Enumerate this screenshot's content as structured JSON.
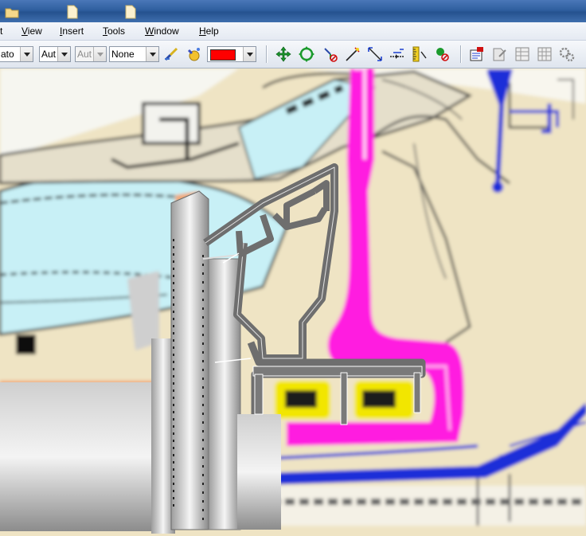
{
  "menu": {
    "items": [
      {
        "label": "t",
        "underline_index": -1
      },
      {
        "label": "View",
        "underline_index": 0
      },
      {
        "label": "Insert",
        "underline_index": 0
      },
      {
        "label": "Tools",
        "underline_index": 0
      },
      {
        "label": "Window",
        "underline_index": 0
      },
      {
        "label": "Help",
        "underline_index": 0
      }
    ]
  },
  "toolbar": {
    "combo1": "ato",
    "combo2": "Aut",
    "combo3": "Aut",
    "linetype": "None",
    "color_value": "#ff0000",
    "buttons": [
      "brush-icon",
      "fill-bucket-icon",
      "pan-icon",
      "rotate-icon",
      "move-axis-icon",
      "snap-point-icon",
      "dimension-icon",
      "align-icon",
      "ruler-icon",
      "analyze-icon",
      "properties-icon",
      "catalog-icon",
      "table-icon",
      "grid-icon",
      "gear-icon"
    ]
  },
  "colors": {
    "title_bar": "#2f5f9f",
    "canvas_beige": "#efe4c4",
    "magenta_part": "#ff1ee0",
    "blue_part": "#1f2fd8",
    "cyan_part": "#c8f0f6",
    "yellow_seal": "#f2e600"
  }
}
